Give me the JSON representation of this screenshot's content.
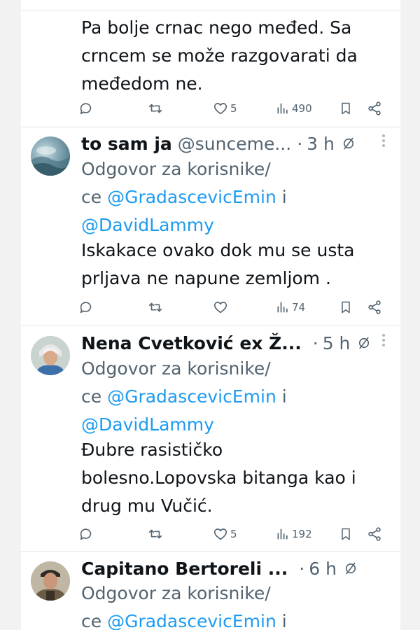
{
  "first_tweet": {
    "text_lines": [
      "Pa bolje crnac nego međed. Sa",
      "crncem se može razgovarati da",
      "međedom ne."
    ],
    "actions": {
      "replies": "",
      "retweets": "",
      "likes": "5",
      "views": "490"
    }
  },
  "tweets": [
    {
      "name": "to sam ja",
      "handle": "@sunceme...",
      "separator": "·",
      "time": "3 h",
      "reply_line1": "Odgovor za korisnike/",
      "reply_prefix": "ce ",
      "mention1": "@GradascevicEmin",
      "reply_join": " i",
      "mention2": "@DavidLammy",
      "text_lines": [
        "Iskakace ovako dok mu se usta",
        "prljava ne napune zemljom ."
      ],
      "actions": {
        "replies": "",
        "retweets": "",
        "likes": "",
        "views": "74"
      }
    },
    {
      "name": "Nena Cvetković ex Ž...",
      "handle": "",
      "separator": "·",
      "time": "5 h",
      "reply_line1": "Odgovor za korisnike/",
      "reply_prefix": "ce ",
      "mention1": "@GradascevicEmin",
      "reply_join": " i",
      "mention2": "@DavidLammy",
      "text_lines": [
        "Đubre rasističko",
        "bolesno.Lopovska bitanga kao i",
        "drug mu Vučić."
      ],
      "actions": {
        "replies": "",
        "retweets": "",
        "likes": "5",
        "views": "192"
      }
    },
    {
      "name": "Capitano Bertoreli ...",
      "handle": "",
      "separator": "·",
      "time": "6 h",
      "reply_line1": "Odgovor za korisnike/",
      "reply_prefix": "ce ",
      "mention1": "@GradascevicEmin",
      "reply_join": " i"
    }
  ],
  "icons": {
    "reply": "reply-icon",
    "retweet": "retweet-icon",
    "like": "heart-icon",
    "views": "views-icon",
    "bookmark": "bookmark-icon",
    "share": "share-icon",
    "grok": "grok-icon",
    "more": "more-dots-icon"
  },
  "colors": {
    "text": "#0f1419",
    "secondary": "#536471",
    "link": "#1d9bf0",
    "divider": "#e6e6e6"
  }
}
